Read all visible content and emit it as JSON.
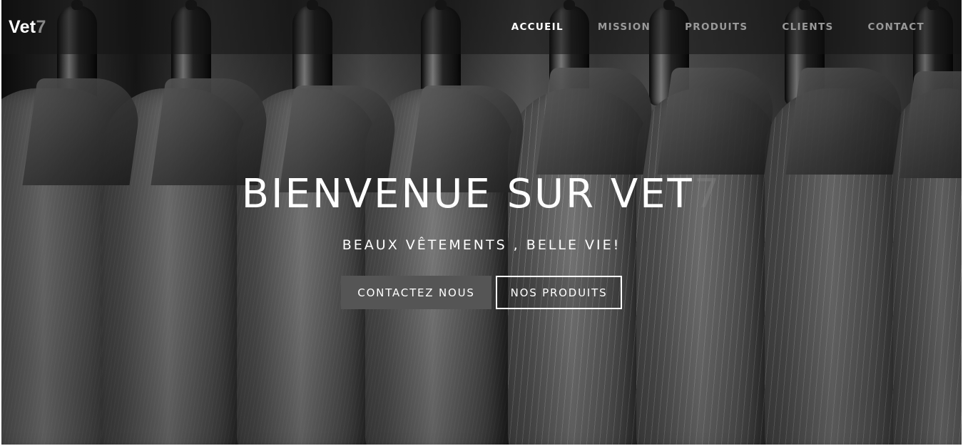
{
  "brand": {
    "main": "Vet",
    "accent": "7"
  },
  "nav": {
    "items": [
      {
        "label": "ACCUEIL",
        "active": true
      },
      {
        "label": "MISSION",
        "active": false
      },
      {
        "label": "PRODUITS",
        "active": false
      },
      {
        "label": "CLIENTS",
        "active": false
      },
      {
        "label": "CONTACT",
        "active": false
      }
    ]
  },
  "hero": {
    "headline_main": "BIENVENUE SUR VET",
    "headline_accent": "7",
    "subtitle": "BEAUX VÊTEMENTS , BELLE VIE!",
    "buttons": {
      "contact": "CONTACTEZ NOUS",
      "products": "NOS PRODUITS"
    },
    "background": "suit-jackets-on-hangers-photo"
  },
  "colors": {
    "accent_gray": "#888888",
    "button_fill": "#555555",
    "text": "#ffffff"
  }
}
